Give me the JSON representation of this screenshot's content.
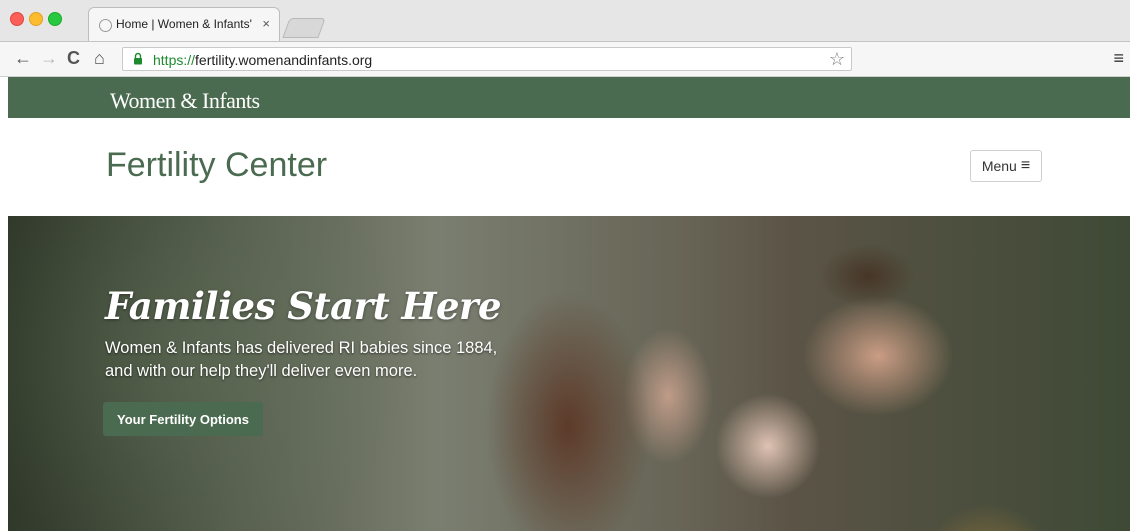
{
  "browser": {
    "tab_title": "Home | Women & Infants' F",
    "tab_close": "×",
    "url_scheme": "https://",
    "url_host": "fertility.womenandinfants.org"
  },
  "site": {
    "brand": "Women & Infants",
    "title": "Fertility Center",
    "menu_label": "Menu"
  },
  "hero": {
    "headline": "Families Start Here",
    "line1": "Women & Infants has delivered RI babies since 1884,",
    "line2": "and with our help they'll deliver even more.",
    "cta_label": "Your Fertility Options"
  },
  "colors": {
    "brand_green": "#4b6b51"
  }
}
